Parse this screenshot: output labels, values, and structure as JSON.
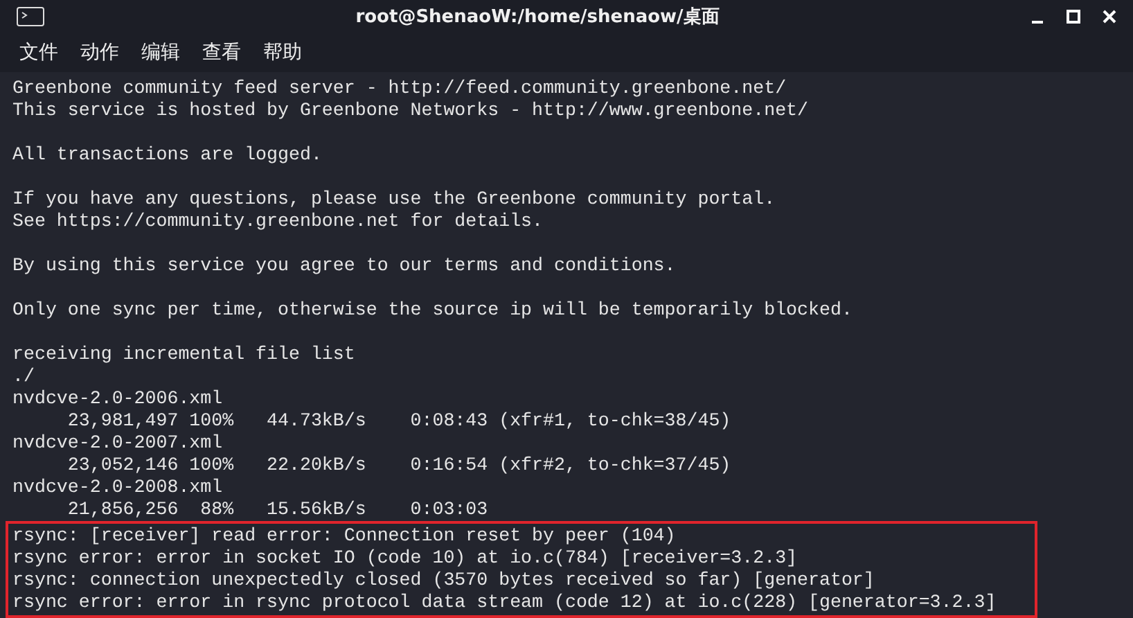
{
  "window": {
    "title": "root@ShenaoW:/home/shenaow/桌面"
  },
  "menu": [
    "文件",
    "动作",
    "编辑",
    "查看",
    "帮助"
  ],
  "terminal": {
    "paragraphs": [
      [
        "Greenbone community feed server - http://feed.community.greenbone.net/",
        "This service is hosted by Greenbone Networks - http://www.greenbone.net/"
      ],
      [
        "All transactions are logged."
      ],
      [
        "If you have any questions, please use the Greenbone community portal.",
        "See https://community.greenbone.net for details."
      ],
      [
        "By using this service you agree to our terms and conditions."
      ],
      [
        "Only one sync per time, otherwise the source ip will be temporarily blocked."
      ],
      [
        "receiving incremental file list",
        "./",
        "nvdcve-2.0-2006.xml",
        "     23,981,497 100%   44.73kB/s    0:08:43 (xfr#1, to-chk=38/45)",
        "nvdcve-2.0-2007.xml",
        "     23,052,146 100%   22.20kB/s    0:16:54 (xfr#2, to-chk=37/45)",
        "nvdcve-2.0-2008.xml",
        "     21,856,256  88%   15.56kB/s    0:03:03"
      ]
    ],
    "highlighted_lines": [
      "rsync: [receiver] read error: Connection reset by peer (104)",
      "rsync error: error in socket IO (code 10) at io.c(784) [receiver=3.2.3]",
      "rsync: connection unexpectedly closed (3570 bytes received so far) [generator]",
      "rsync error: error in rsync protocol data stream (code 12) at io.c(228) [generator=3.2.3]"
    ]
  }
}
